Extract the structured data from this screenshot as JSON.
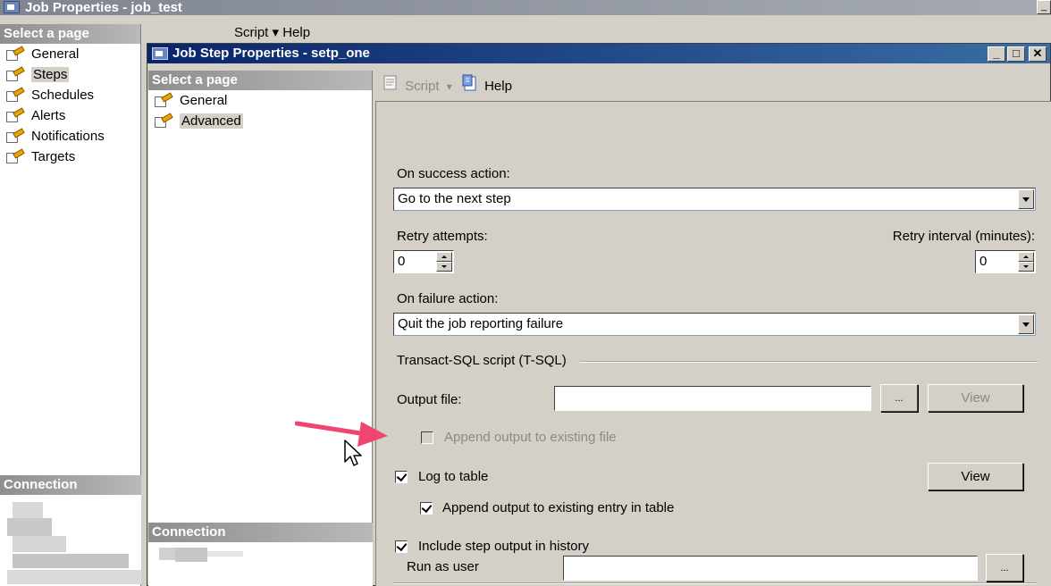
{
  "background_window": {
    "title": "Job Properties - job_test",
    "select_page_header": "Select a page",
    "nav_items": [
      "General",
      "Steps",
      "Schedules",
      "Alerts",
      "Notifications",
      "Targets"
    ],
    "selected_item": "Steps",
    "toolbar_text": "Script  ▾  Help",
    "connection_header": "Connection"
  },
  "dialog": {
    "title": "Job Step Properties - setp_one",
    "caption_buttons": {
      "minimize": "_",
      "maximize": "□",
      "close": "✕"
    },
    "select_page_header": "Select a page",
    "nav_items": [
      "General",
      "Advanced"
    ],
    "selected_item": "Advanced",
    "connection_header": "Connection",
    "toolbar": {
      "script_label": "Script",
      "script_arrow": "▾",
      "help_label": "Help"
    },
    "form": {
      "on_success_label": "On success action:",
      "on_success_value": "Go to the next step",
      "retry_attempts_label": "Retry attempts:",
      "retry_attempts_value": "0",
      "retry_interval_label": "Retry interval (minutes):",
      "retry_interval_value": "0",
      "on_failure_label": "On failure action:",
      "on_failure_value": "Quit the job reporting failure",
      "tsql_section_label": "Transact-SQL script (T-SQL)",
      "output_file_label": "Output file:",
      "output_file_value": "",
      "browse_label": "...",
      "view_label": "View",
      "append_output_label": "Append output to existing file",
      "log_to_table_label": "Log to table",
      "log_view_label": "View",
      "append_entry_label": "Append output to existing entry in table",
      "include_history_label": "Include step output in history",
      "run_as_user_label": "Run as user",
      "run_as_user_value": "",
      "run_as_browse_label": "..."
    },
    "checkboxes": {
      "append_output": false,
      "log_to_table": true,
      "append_entry": true,
      "include_history": true
    }
  },
  "colors": {
    "arrow": "#f0456e",
    "title_active": "#0a246a"
  }
}
